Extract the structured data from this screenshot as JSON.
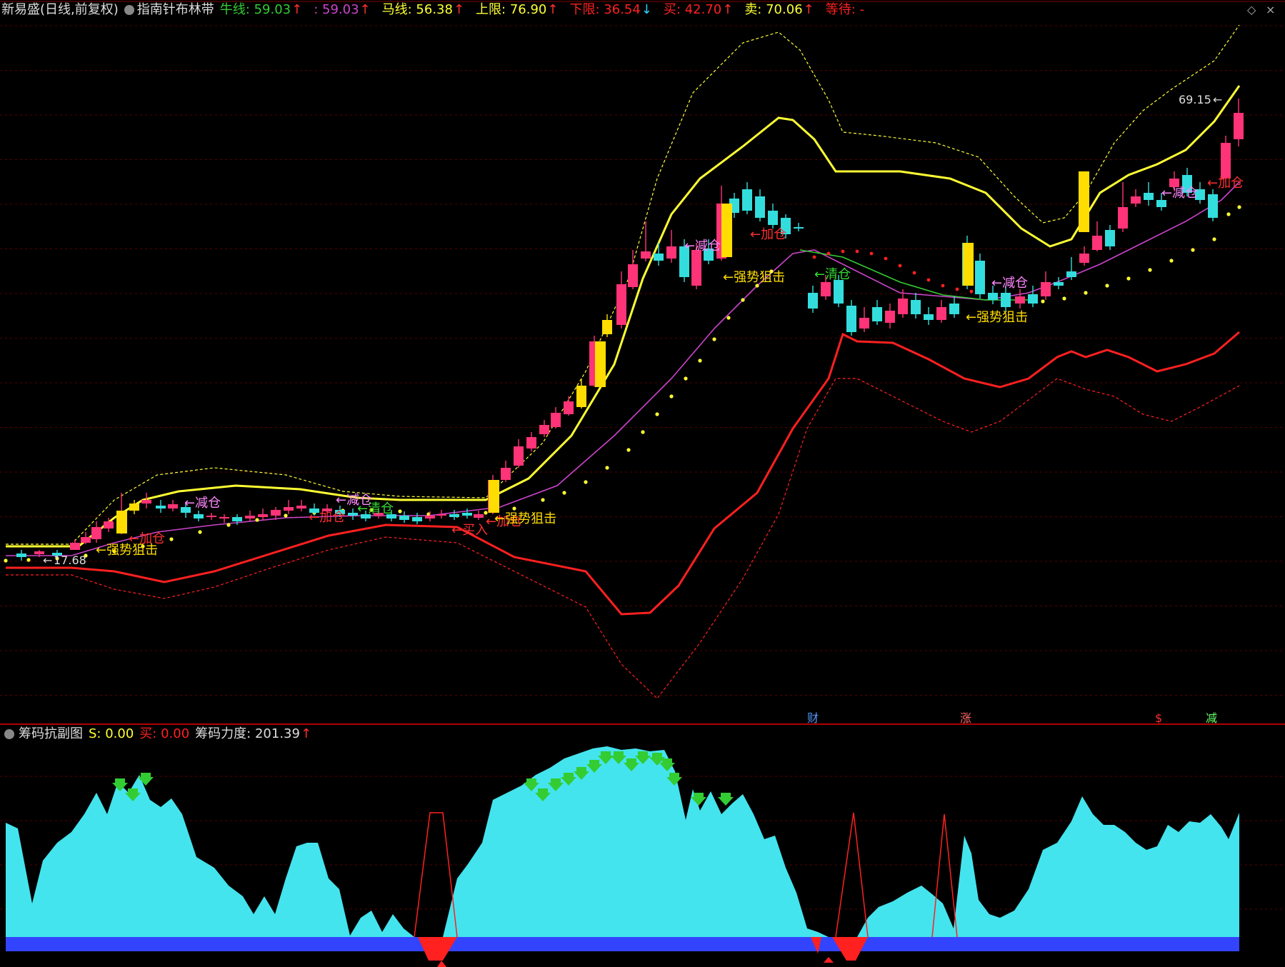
{
  "main_header": {
    "title": "新易盛(日线,前复权)",
    "indicator_name": "指南针布林带",
    "bull_label": "牛线: ",
    "bull_value": "59.03",
    "mid_label": ": ",
    "mid_value": "59.03",
    "horse_label": "马线: ",
    "horse_value": "56.38",
    "upper_label": "上限: ",
    "upper_value": "76.90",
    "lower_label": "下限: ",
    "lower_value": "36.54",
    "buy_label": "买: ",
    "buy_value": "42.70",
    "sell_label": "卖: ",
    "sell_value": "70.06",
    "wait_label": "等待: ",
    "wait_value": "-"
  },
  "sub_header": {
    "title": "筹码抗副图",
    "s_label": "S: ",
    "s_value": "0.00",
    "buy_label": "买: ",
    "buy_value": "0.00",
    "force_label": "筹码力度: ",
    "force_value": "201.39"
  },
  "annotations": {
    "high_price": "69.15",
    "low_price": "17.68",
    "reduce": "←减仓",
    "add": "←加仓",
    "strong": "←强势狙击",
    "clear": "←清仓",
    "buy": "←买入",
    "event_cai": "财",
    "event_zhang": "涨",
    "event_dollar": "$",
    "event_jian": "减"
  },
  "colors": {
    "bull": "#ffff33",
    "mid": "#cc44cc",
    "horse": "#33cc33",
    "upper": "#ffff33",
    "lower": "#ff2020",
    "rise": "#ff3377",
    "fall": "#33dddd",
    "strong": "#ffdd00",
    "area": "#44e4ee",
    "bar": "#3344ff"
  },
  "chart_data": {
    "type": "candlestick",
    "price_high_marker": 69.15,
    "price_low_marker": 17.68,
    "indicator": "指南针布林带",
    "sub_indicator": "筹码抗副图"
  }
}
